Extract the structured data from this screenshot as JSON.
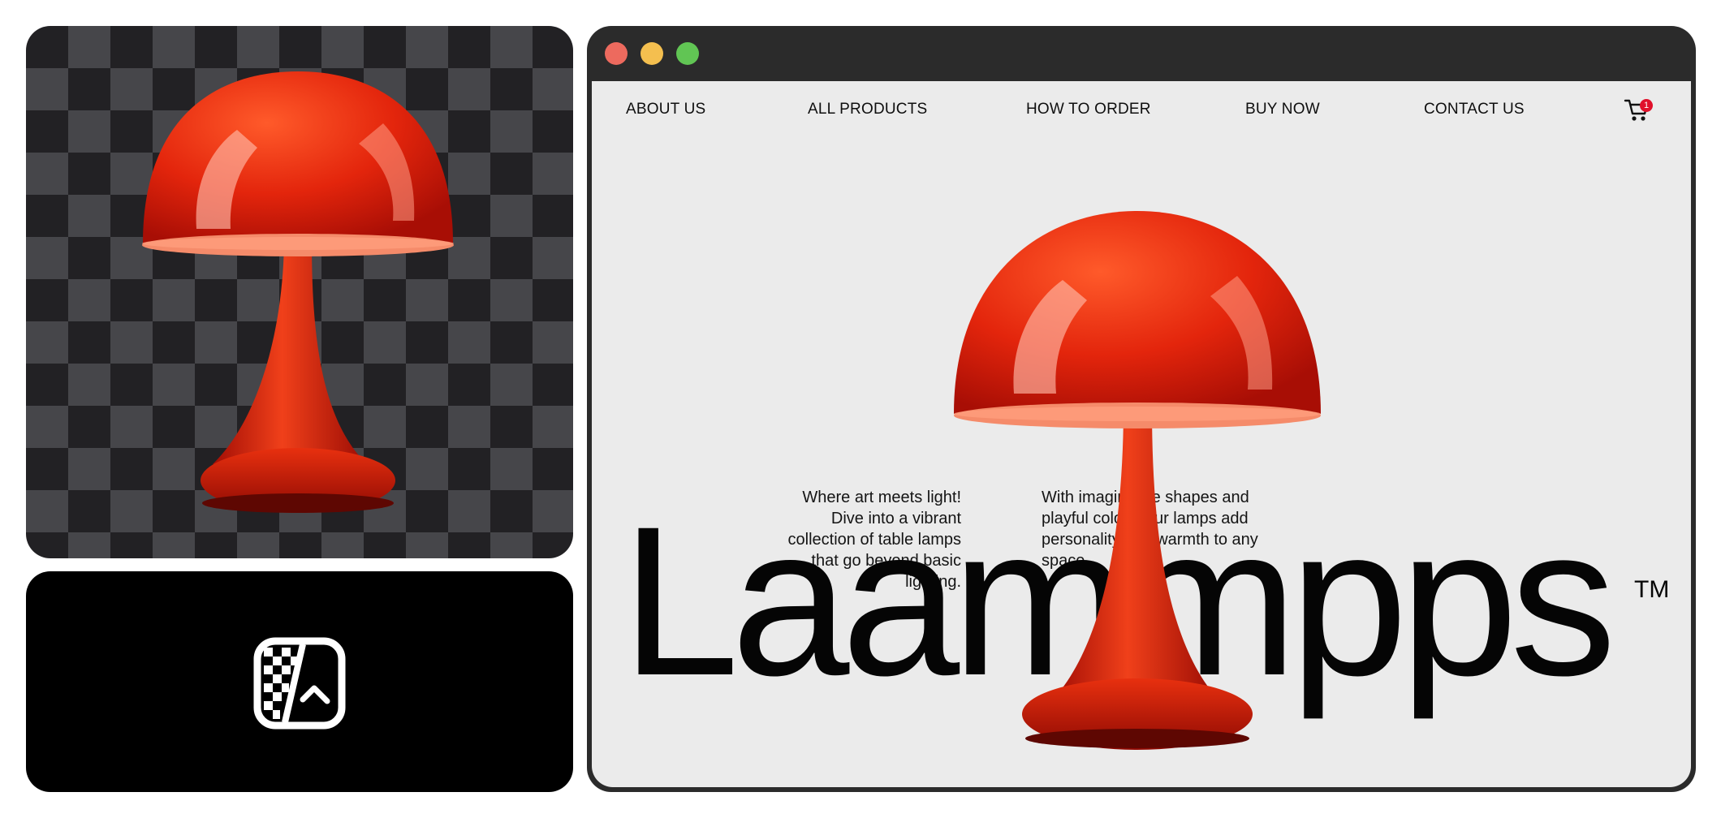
{
  "nav": {
    "items": [
      "ABOUT US",
      "ALL PRODUCTS",
      "HOW TO ORDER",
      "BUY NOW",
      "CONTACT US"
    ],
    "cart_count": "1"
  },
  "hero": {
    "brand": "Laammpps",
    "trademark": "TM",
    "blurb_left": "Where art meets light! Dive into a vibrant collection of table lamps that go beyond basic lighting.",
    "blurb_right": "With imaginative shapes and playful colors, our lamps add personality and warmth to any space."
  },
  "icons": {
    "window_controls": [
      "close-dot",
      "minimize-dot",
      "maximize-dot"
    ],
    "cart": "cart-icon",
    "logo": "background-remover-logo-icon",
    "product": "red-mushroom-lamp-image"
  },
  "colors": {
    "lamp_red": "#e8240e",
    "browser_chrome": "#2b2b2b",
    "viewport_bg": "#ebebeb",
    "badge_red": "#e0102a"
  }
}
